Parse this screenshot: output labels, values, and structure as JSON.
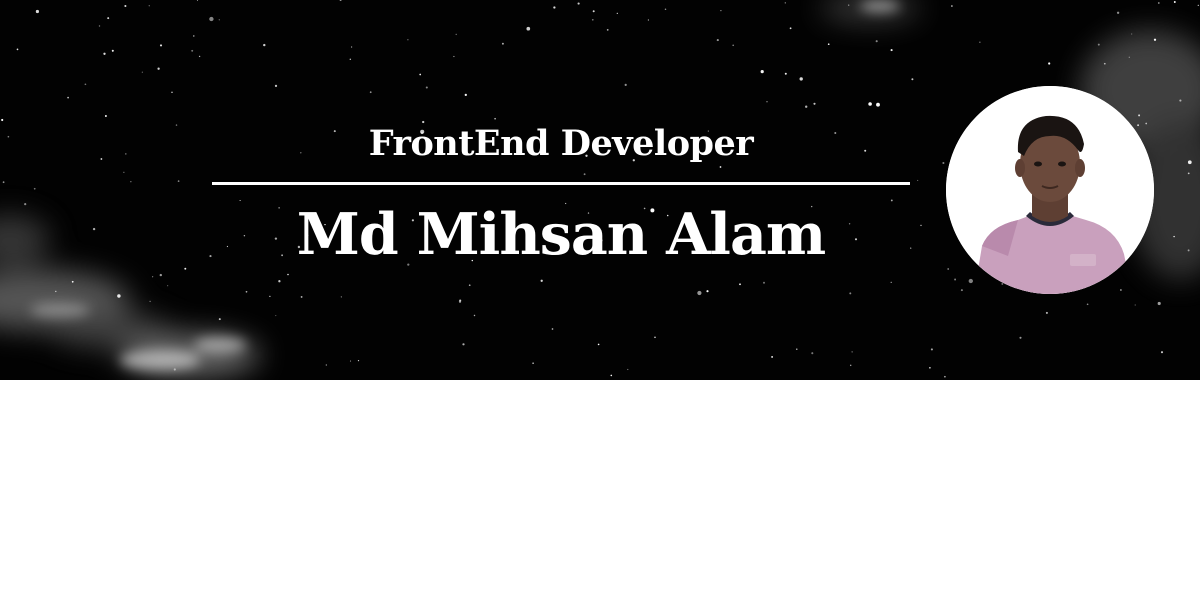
{
  "banner": {
    "role": "FrontEnd Developer",
    "name": "Md Mihsan Alam",
    "colors": {
      "background": "#020202",
      "text": "#ffffff",
      "divider": "#ffffff",
      "page": "#ffffff"
    }
  },
  "avatar": {
    "icon": "profile-photo-icon",
    "colors": {
      "background": "#ffffff",
      "shirt": "#c9a0bd",
      "skin": "#6b4a3c",
      "hair": "#1a1412"
    }
  }
}
